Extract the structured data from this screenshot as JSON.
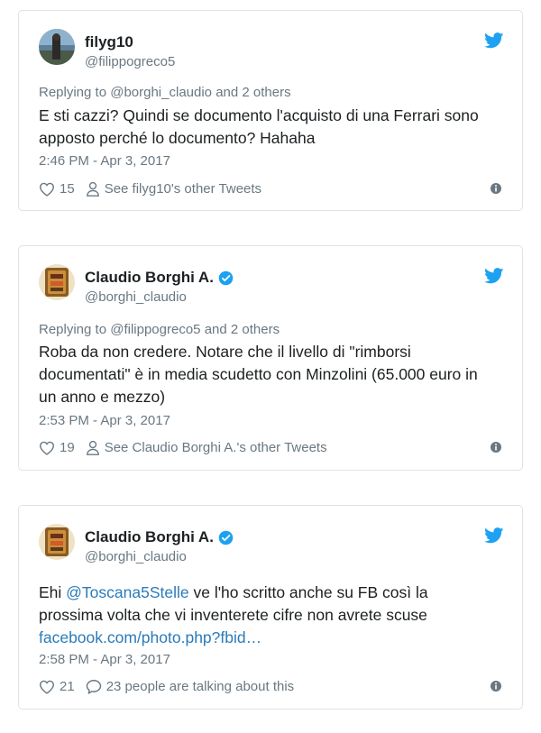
{
  "tweets": [
    {
      "display_name": "filyg10",
      "handle": "@filippogreco5",
      "reply_prefix": "Replying to",
      "reply_mention": "@borghi_claudio",
      "reply_suffix": "and 2 others",
      "text_lines": [
        "E sti cazzi? Quindi se documento l'acquisto di una Ferrari sono",
        "apposto perché lo documento? Hahaha"
      ],
      "timestamp": "2:46 PM - Apr 3, 2017",
      "likes": "15",
      "secondary_action": "See filyg10's other Tweets"
    },
    {
      "display_name": "Claudio Borghi A.",
      "handle": "@borghi_claudio",
      "reply_prefix": "Replying to",
      "reply_mention": "@filippogreco5",
      "reply_suffix": "and 2 others",
      "text_lines": [
        "Roba da non credere. Notare che il livello di \"rimborsi",
        "documentati\" è in media scudetto con Minzolini (65.000 euro in",
        "un anno e mezzo)"
      ],
      "timestamp": "2:53 PM - Apr 3, 2017",
      "likes": "19",
      "secondary_action": "See Claudio Borghi A.'s other Tweets"
    },
    {
      "display_name": "Claudio Borghi A.",
      "handle": "@borghi_claudio",
      "text_prefix": "Ehi ",
      "text_mention": "@Toscana5Stelle",
      "text_line1_rest": " ve l'ho scritto anche su FB così la",
      "text_line2": "prossima volta che vi inventerete cifre non avrete scuse",
      "text_link": "facebook.com/photo.php?fbid…",
      "timestamp": "2:58 PM - Apr 3, 2017",
      "likes": "21",
      "secondary_action": "23 people are talking about this"
    }
  ],
  "colors": {
    "twitter_blue": "#1da1f2",
    "link": "#2b7bb9",
    "muted": "#697882",
    "text": "#1c2022",
    "verified": "#1da1f2"
  },
  "icons": [
    "twitter-bird-icon",
    "heart-icon",
    "person-icon",
    "comment-icon",
    "info-icon",
    "verified-icon"
  ]
}
